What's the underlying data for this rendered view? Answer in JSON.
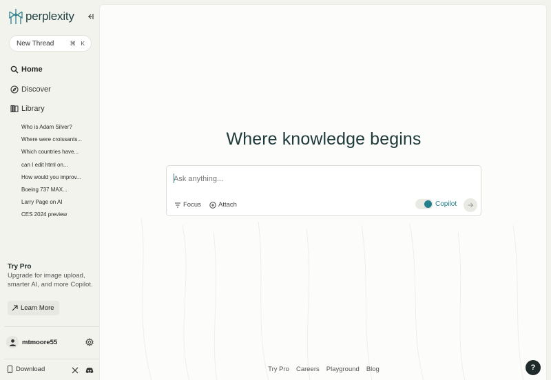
{
  "app": {
    "name": "perplexity",
    "accent_color": "#22808d",
    "brand_color": "#1f3f40"
  },
  "sidebar": {
    "collapse_icon": "collapse-left-icon",
    "new_thread": {
      "label": "New Thread",
      "shortcut_cmd": "⌘",
      "shortcut_key": "K"
    },
    "nav": [
      {
        "label": "Home",
        "icon": "search-icon",
        "active": true
      },
      {
        "label": "Discover",
        "icon": "compass-icon",
        "active": false
      },
      {
        "label": "Library",
        "icon": "library-icon",
        "active": false
      }
    ],
    "threads": [
      "Who is Adam Silver?",
      "Where were croissants...",
      "Which countries have...",
      "can I edit html on...",
      "How would you improv...",
      "Boeing 737 MAX...",
      "Larry Page on AI",
      "CES 2024 preview"
    ],
    "try_pro": {
      "title": "Try Pro",
      "description": "Upgrade for image upload, smarter AI, and more Copilot.",
      "button": "Learn More"
    },
    "user": {
      "name": "mtmoore55"
    },
    "download_label": "Download"
  },
  "main": {
    "headline": "Where knowledge begins",
    "search": {
      "placeholder": "Ask anything...",
      "value": "",
      "focus_label": "Focus",
      "attach_label": "Attach",
      "copilot_label": "Copilot",
      "copilot_on": true
    },
    "footer_links": [
      "Try Pro",
      "Careers",
      "Playground",
      "Blog"
    ],
    "help_label": "?"
  }
}
